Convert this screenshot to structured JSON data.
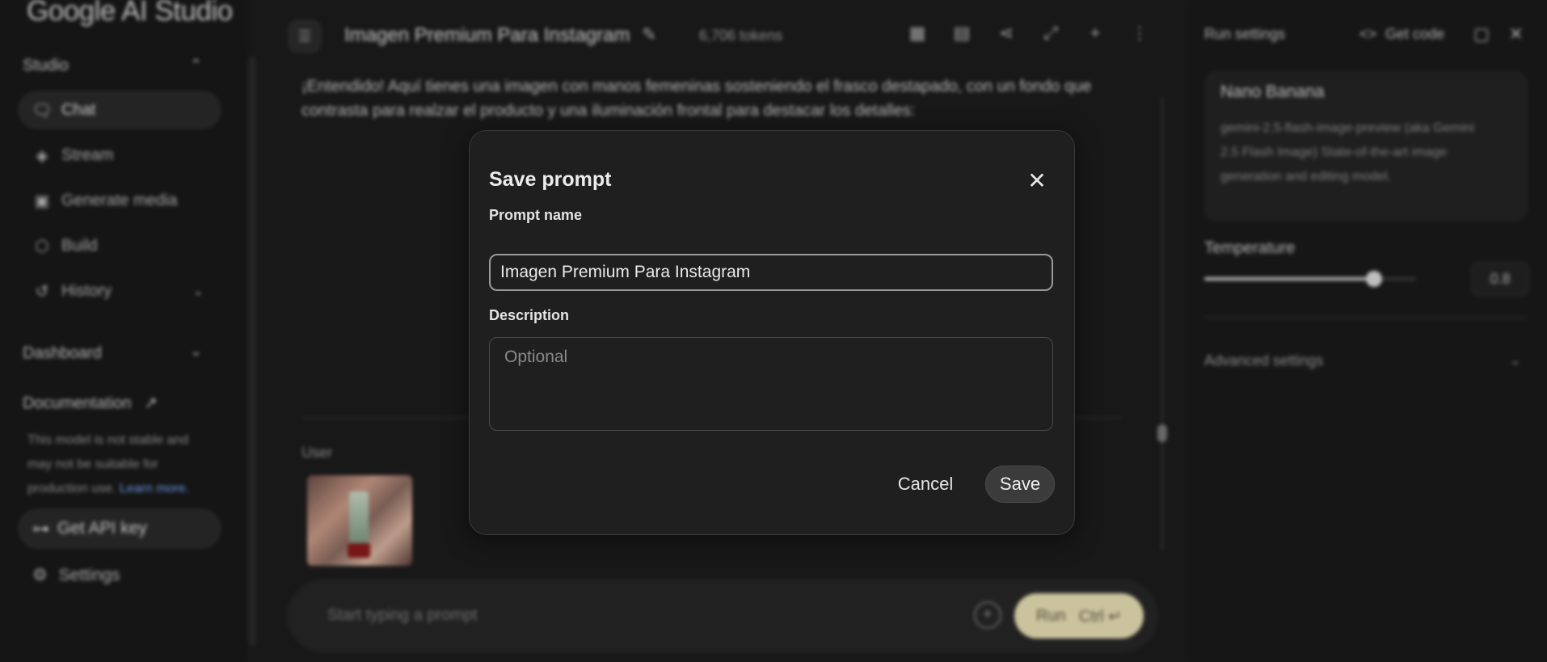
{
  "sidebar": {
    "brand": "Google AI Studio",
    "sections": {
      "studio": "Studio",
      "dashboard": "Dashboard",
      "documentation": "Documentation"
    },
    "items": [
      {
        "label": "Chat",
        "icon": "chat-icon"
      },
      {
        "label": "Stream",
        "icon": "stream-icon"
      },
      {
        "label": "Generate media",
        "icon": "media-icon"
      },
      {
        "label": "Build",
        "icon": "build-icon"
      },
      {
        "label": "History",
        "icon": "history-icon"
      }
    ],
    "note_text": "This model is not stable and may not be suitable for production use.",
    "note_link": "Learn more.",
    "api_key_label": "Get API key",
    "settings_label": "Settings"
  },
  "header": {
    "title": "Imagen Premium Para Instagram",
    "tokens": "6,706 tokens"
  },
  "chat": {
    "model_message": "¡Entendido! Aquí tienes una imagen con manos femeninas sosteniendo el frasco destapado, con un fondo que contrasta para realzar el producto y una iluminación frontal para destacar los detalles:",
    "user_label": "User",
    "prompt_placeholder": "Start typing a prompt",
    "run_label": "Run",
    "run_shortcut": "Ctrl ↵"
  },
  "run_settings": {
    "title": "Run settings",
    "get_code": "Get code",
    "model_name": "Nano Banana",
    "model_desc": "gemini-2.5-flash-image-preview (aka Gemini 2.5 Flash Image) State-of-the-art image generation and editing model.",
    "temperature_label": "Temperature",
    "temperature_value": "0.8",
    "temperature_fraction": 0.8,
    "advanced_label": "Advanced settings"
  },
  "dialog": {
    "title": "Save prompt",
    "name_label": "Prompt name",
    "name_value": "Imagen Premium Para Instagram",
    "description_label": "Description",
    "description_placeholder": "Optional",
    "cancel_label": "Cancel",
    "save_label": "Save"
  },
  "colors": {
    "background": "#1c1c1c",
    "dialog_bg": "#1f1f1f",
    "run_button": "#e8dfb4",
    "link": "#7aa7ff"
  }
}
